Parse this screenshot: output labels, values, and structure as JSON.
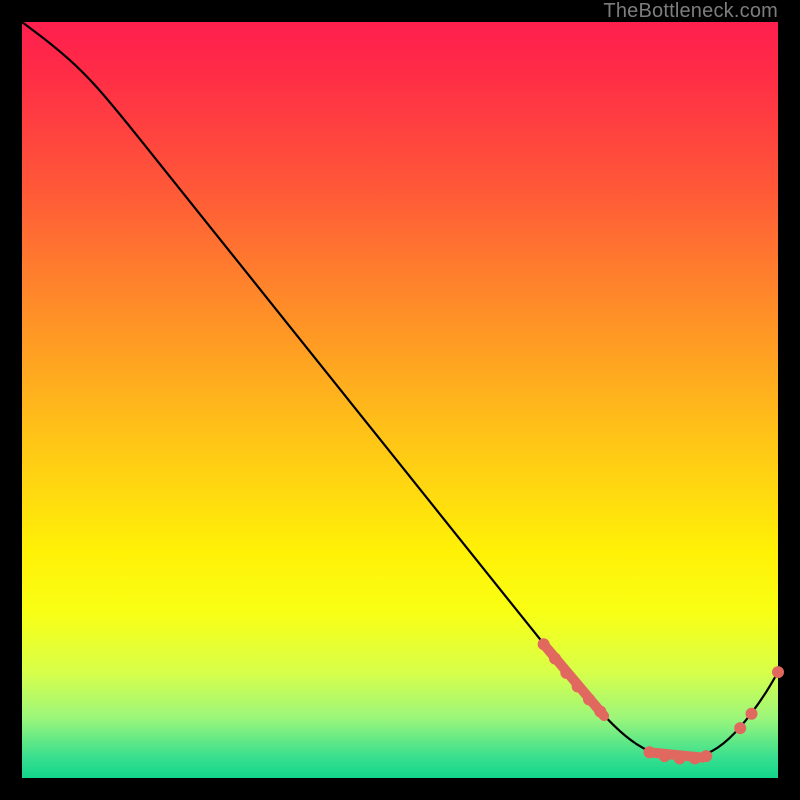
{
  "watermark": "TheBottleneck.com",
  "colors": {
    "background": "#000000",
    "curve": "#000000",
    "marker": "#e0685f",
    "gradient_top": "#ff1f4f",
    "gradient_bottom": "#12d68c"
  },
  "chart_data": {
    "type": "line",
    "title": "",
    "xlabel": "",
    "ylabel": "",
    "xlim": [
      0,
      100
    ],
    "ylim": [
      0,
      100
    ],
    "grid": false,
    "legend": false,
    "series": [
      {
        "name": "curve",
        "x": [
          0,
          4,
          8,
          12,
          20,
          30,
          40,
          50,
          60,
          68,
          73,
          77,
          80,
          83,
          86,
          89,
          92,
          95,
          98,
          100
        ],
        "y": [
          100,
          97,
          93.5,
          89,
          79,
          66.5,
          54,
          41.5,
          29,
          19,
          12.8,
          8.2,
          5.3,
          3.4,
          2.6,
          2.6,
          3.8,
          6.6,
          10.6,
          14
        ]
      }
    ],
    "markers": [
      {
        "type": "segment",
        "x0": 69,
        "y0": 17.7,
        "x1": 77,
        "y1": 8.2
      },
      {
        "type": "segment",
        "x0": 83,
        "y0": 3.4,
        "x1": 90,
        "y1": 2.7
      },
      {
        "type": "dot",
        "x": 69,
        "y": 17.7
      },
      {
        "type": "dot",
        "x": 70.5,
        "y": 15.8
      },
      {
        "type": "dot",
        "x": 72,
        "y": 13.9
      },
      {
        "type": "dot",
        "x": 73.5,
        "y": 12.1
      },
      {
        "type": "dot",
        "x": 75,
        "y": 10.4
      },
      {
        "type": "dot",
        "x": 76.5,
        "y": 8.8
      },
      {
        "type": "dot",
        "x": 83,
        "y": 3.4
      },
      {
        "type": "dot",
        "x": 85,
        "y": 2.9
      },
      {
        "type": "dot",
        "x": 87,
        "y": 2.6
      },
      {
        "type": "dot",
        "x": 89,
        "y": 2.6
      },
      {
        "type": "dot",
        "x": 90.5,
        "y": 2.9
      },
      {
        "type": "dot",
        "x": 95,
        "y": 6.6
      },
      {
        "type": "dot",
        "x": 96.5,
        "y": 8.5
      },
      {
        "type": "dot",
        "x": 100,
        "y": 14
      }
    ],
    "gradient_bands_pct": [
      {
        "color": "#ff1f4f",
        "at": 0
      },
      {
        "color": "#ff3b42",
        "at": 12
      },
      {
        "color": "#ff7a2e",
        "at": 32
      },
      {
        "color": "#ffbb1a",
        "at": 52
      },
      {
        "color": "#fff106",
        "at": 70
      },
      {
        "color": "#d8ff4a",
        "at": 86
      },
      {
        "color": "#12d68c",
        "at": 100
      }
    ]
  }
}
